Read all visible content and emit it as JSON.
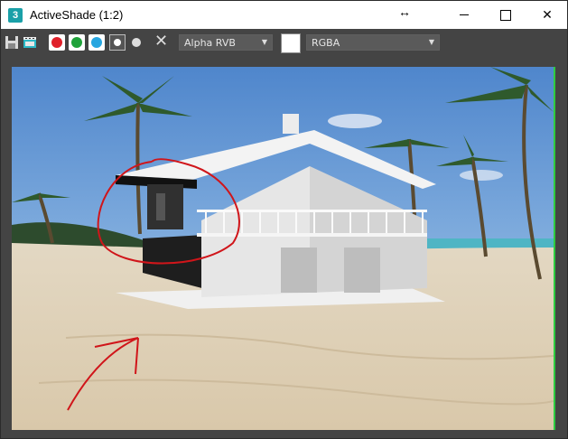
{
  "window": {
    "app_icon_glyph": "3",
    "title": "ActiveShade (1:2)",
    "drag_glyph": "↔",
    "close_glyph": "✕"
  },
  "toolbar": {
    "clear_glyph": "✕",
    "channel_dropdown": {
      "selected": "Alpha RVB"
    },
    "display_dropdown": {
      "selected": "RGBA"
    },
    "colors": {
      "red": "#e0202a",
      "green": "#1fa23a",
      "blue": "#27a6e0"
    }
  },
  "viewport": {
    "icon": "render-image",
    "annotation_color": "#d0151a",
    "border_color": "#2ecc40"
  }
}
